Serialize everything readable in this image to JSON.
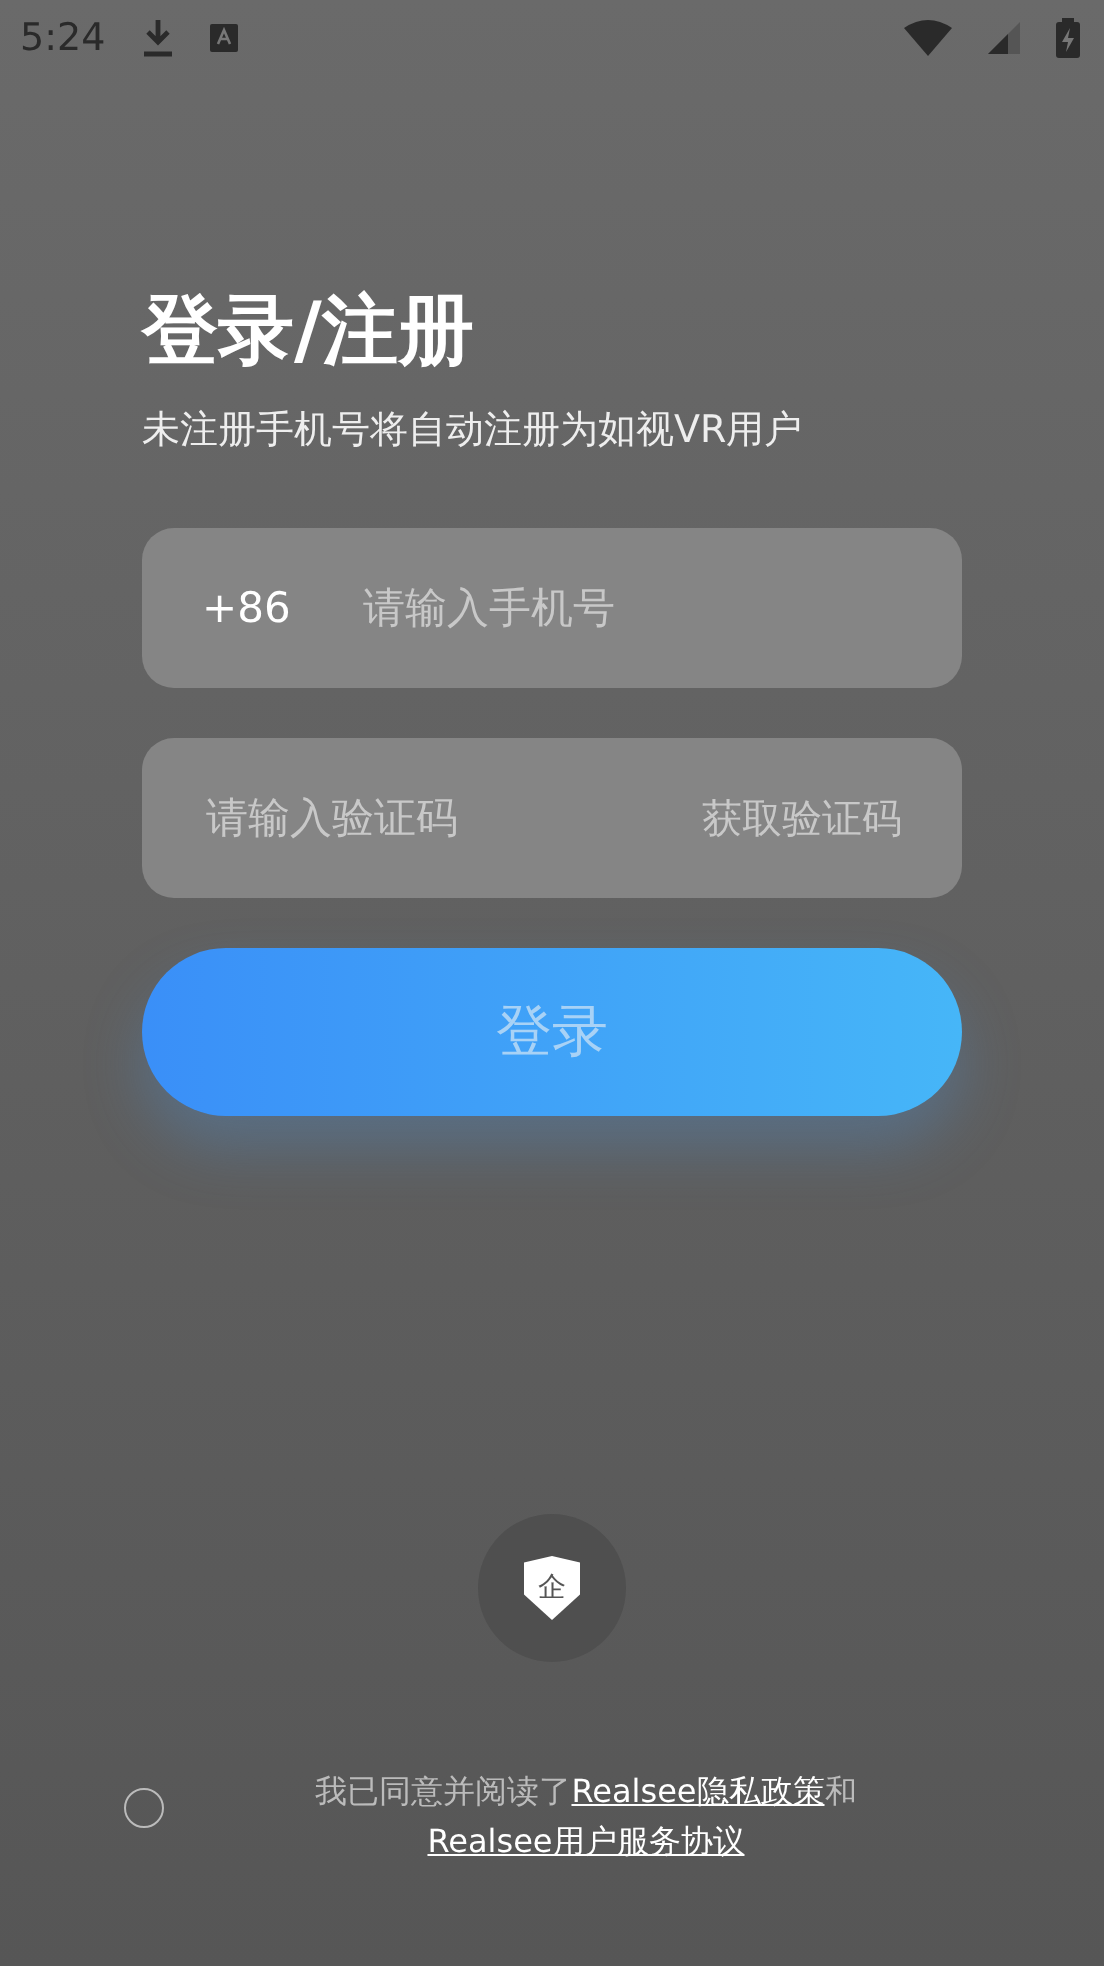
{
  "status_bar": {
    "time": "5:24"
  },
  "title": "登录/注册",
  "subtitle": "未注册手机号将自动注册为如视VR用户",
  "phone_field": {
    "prefix": "+86",
    "placeholder": "请输入手机号"
  },
  "code_field": {
    "placeholder": "请输入验证码",
    "action": "获取验证码"
  },
  "login_button": {
    "label": "登录",
    "disabled": true
  },
  "enterprise_button": {
    "glyph": "企"
  },
  "agreement": {
    "checked": false,
    "text": "我已同意并阅读了",
    "link_1": "Realsee隐私政策",
    "joiner": "和",
    "link_2": "Realsee用户服务协议"
  }
}
